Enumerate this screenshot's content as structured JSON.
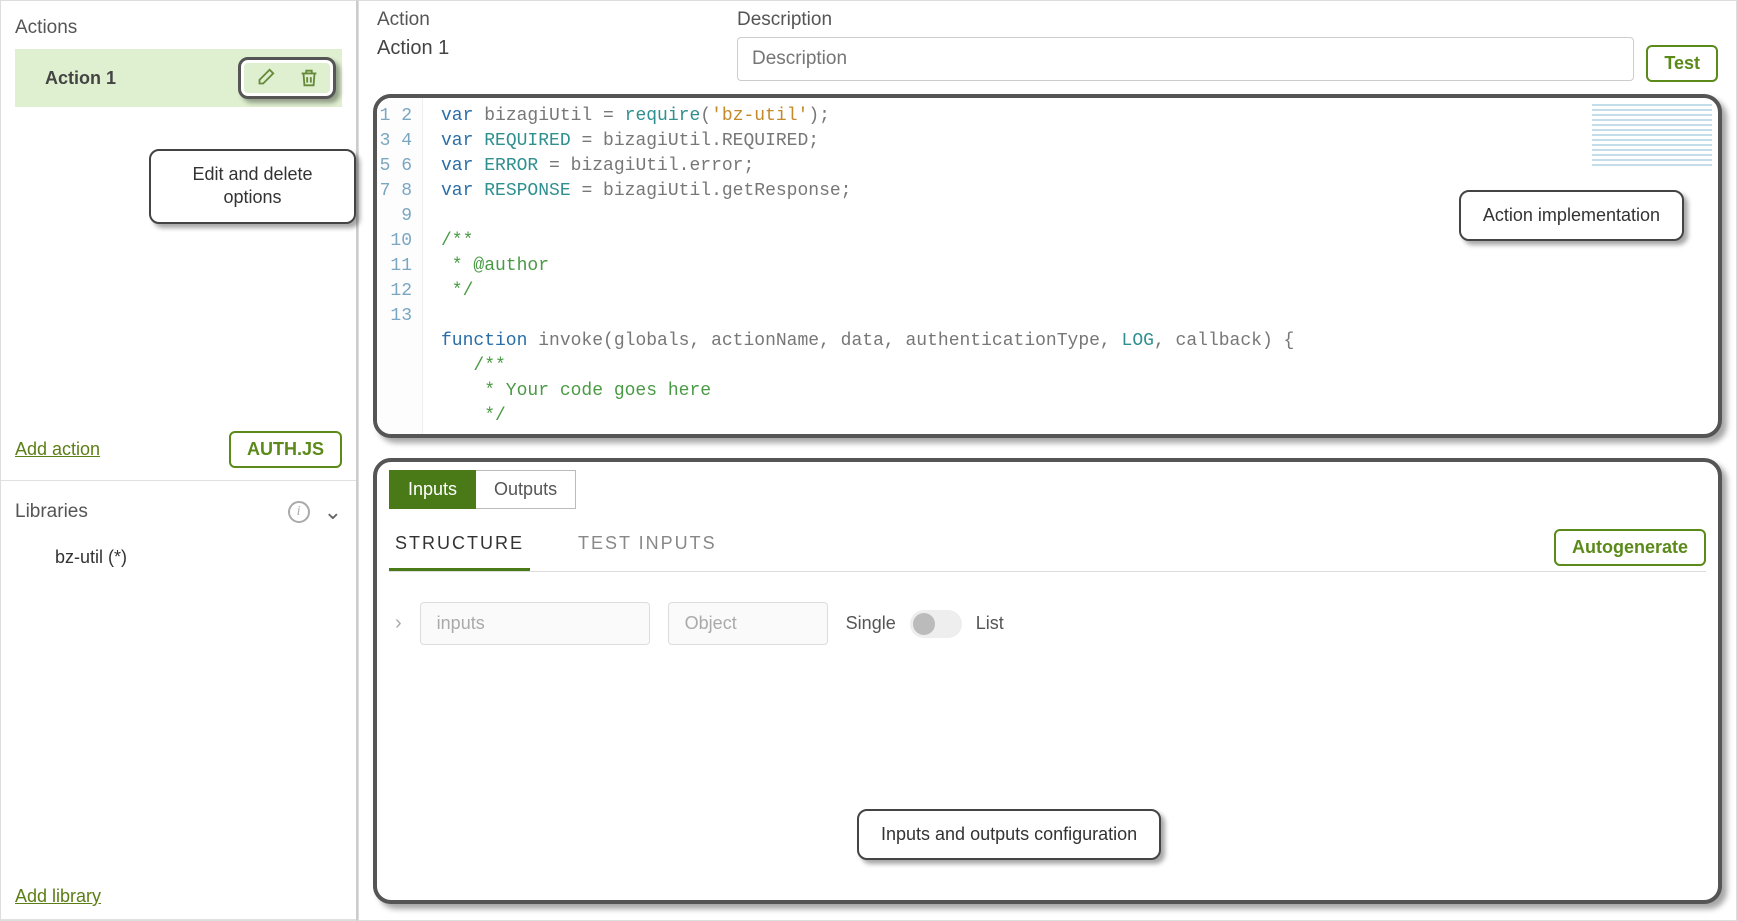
{
  "sidebar": {
    "actions": {
      "header": "Actions",
      "items": [
        {
          "label": "Action 1"
        }
      ],
      "add_label": "Add action",
      "auth_label": "AUTH.JS"
    },
    "libraries": {
      "header": "Libraries",
      "items": [
        {
          "label": "bz-util (*)"
        }
      ],
      "add_label": "Add library"
    }
  },
  "callouts": {
    "edit_delete": "Edit and delete options",
    "action_impl": "Action implementation",
    "io_config": "Inputs and outputs configuration"
  },
  "main": {
    "action_label": "Action",
    "action_value": "Action 1",
    "description_label": "Description",
    "description_placeholder": "Description",
    "test_label": "Test"
  },
  "code": {
    "lines": [
      {
        "n": 1
      },
      {
        "n": 2
      },
      {
        "n": 3
      },
      {
        "n": 4
      },
      {
        "n": 5
      },
      {
        "n": 6
      },
      {
        "n": 7
      },
      {
        "n": 8
      },
      {
        "n": 9
      },
      {
        "n": 10
      },
      {
        "n": 11
      },
      {
        "n": 12
      },
      {
        "n": 13
      }
    ],
    "tokens": {
      "var": "var",
      "bizagiUtilDecl": "bizagiUtil = ",
      "require": "require",
      "bzutil": "'bz-util'",
      "requiredDecl": "REQUIRED",
      "eqBizReq": " = bizagiUtil.REQUIRED;",
      "errorDecl": "ERROR",
      "eqErr": " = bizagiUtil.error;",
      "respDecl": "RESPONSE",
      "eqResp": " = bizagiUtil.getResponse;",
      "cmtOpen": "/**",
      "cmtAuthor": " * @author",
      "cmtClose": " */",
      "fnKw": "function",
      "fnName": " invoke",
      "fnArgs1": "(globals, actionName, data, authenticationType, ",
      "logIdent": "LOG",
      "fnArgs2": ", callback) {",
      "innerCmtOpen": "   /**",
      "innerCmt": "    * Your code goes here",
      "innerCmtClose": "    */",
      "paren": "(",
      "parenClose": ");"
    }
  },
  "io": {
    "tabs": {
      "inputs": "Inputs",
      "outputs": "Outputs"
    },
    "subtabs": {
      "structure": "STRUCTURE",
      "testinputs": "TEST INPUTS"
    },
    "autogenerate": "Autogenerate",
    "row": {
      "name": "inputs",
      "type": "Object",
      "single": "Single",
      "list": "List"
    }
  }
}
